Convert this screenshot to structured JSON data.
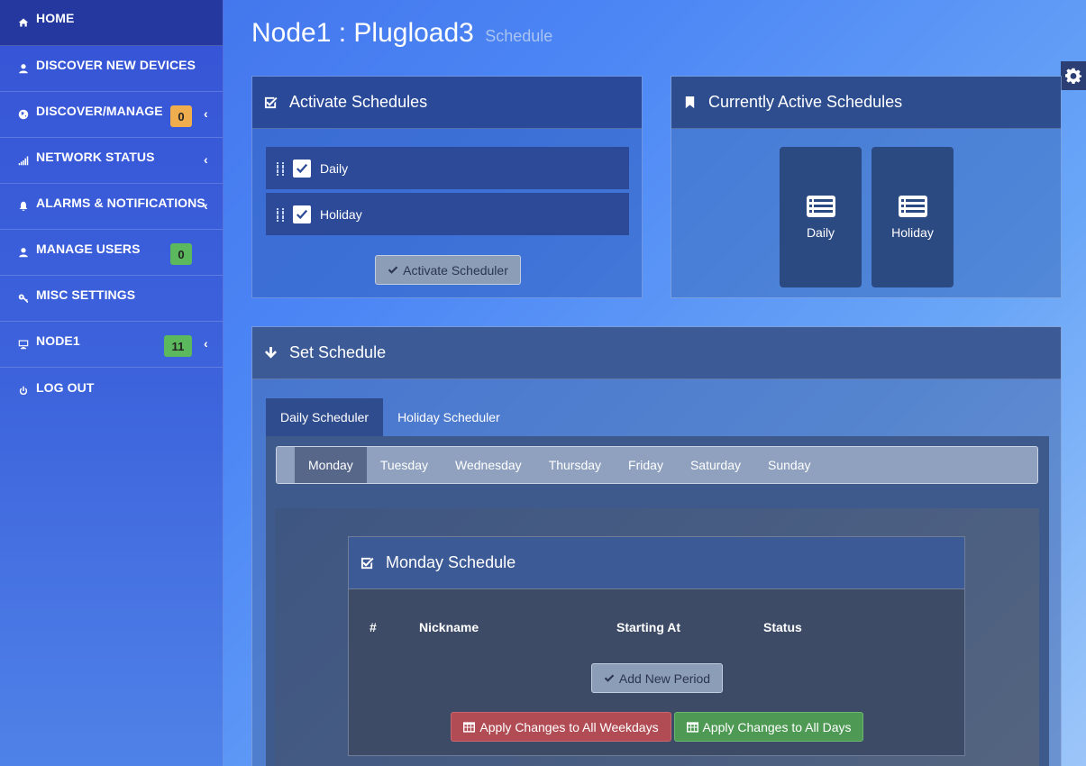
{
  "sidebar": {
    "items": [
      {
        "label": "HOME",
        "icon": "home-icon"
      },
      {
        "label": "DISCOVER NEW DEVICES",
        "icon": "user-icon"
      },
      {
        "label": "DISCOVER/MANAGE",
        "icon": "globe-icon",
        "badge": "0",
        "badge_color": "#f0ad4e"
      },
      {
        "label": "NETWORK STATUS",
        "icon": "signal-icon"
      },
      {
        "label": "ALARMS & NOTIFICATIONS",
        "icon": "bell-icon"
      },
      {
        "label": "MANAGE USERS",
        "icon": "user-icon",
        "badge": "0",
        "badge_color": "#5cb85c"
      },
      {
        "label": "MISC SETTINGS",
        "icon": "key-icon"
      },
      {
        "label": "NODE1",
        "icon": "monitor-icon",
        "badge": "11",
        "badge_color": "#5cb85c"
      },
      {
        "label": "LOG OUT",
        "icon": "power-icon"
      }
    ],
    "chevron": "‹"
  },
  "page": {
    "title": "Node1 : Plugload3",
    "subtitle": "Schedule"
  },
  "activate_panel": {
    "title": "Activate Schedules",
    "schedules": [
      {
        "label": "Daily",
        "checked": true
      },
      {
        "label": "Holiday",
        "checked": true
      }
    ],
    "button": "Activate Scheduler"
  },
  "current_panel": {
    "title": "Currently Active Schedules",
    "tiles": [
      "Daily",
      "Holiday"
    ]
  },
  "set_panel": {
    "title": "Set Schedule",
    "tabs": [
      "Daily Scheduler",
      "Holiday Scheduler"
    ],
    "active_tab": "Daily Scheduler",
    "days": [
      "Monday",
      "Tuesday",
      "Wednesday",
      "Thursday",
      "Friday",
      "Saturday",
      "Sunday"
    ],
    "active_day": "Monday"
  },
  "day_schedule": {
    "title": "Monday Schedule",
    "columns": [
      "#",
      "Nickname",
      "Starting At",
      "Status"
    ],
    "add_button": "Add New Period",
    "apply_weekdays": "Apply Changes to All Weekdays",
    "apply_all_days": "Apply Changes to All Days"
  },
  "colors": {
    "sidebar_active": "#24389f",
    "badge_orange": "#f0ad4e",
    "badge_green": "#5cb85c",
    "danger": "#b14c55",
    "success": "#4e9a55"
  }
}
